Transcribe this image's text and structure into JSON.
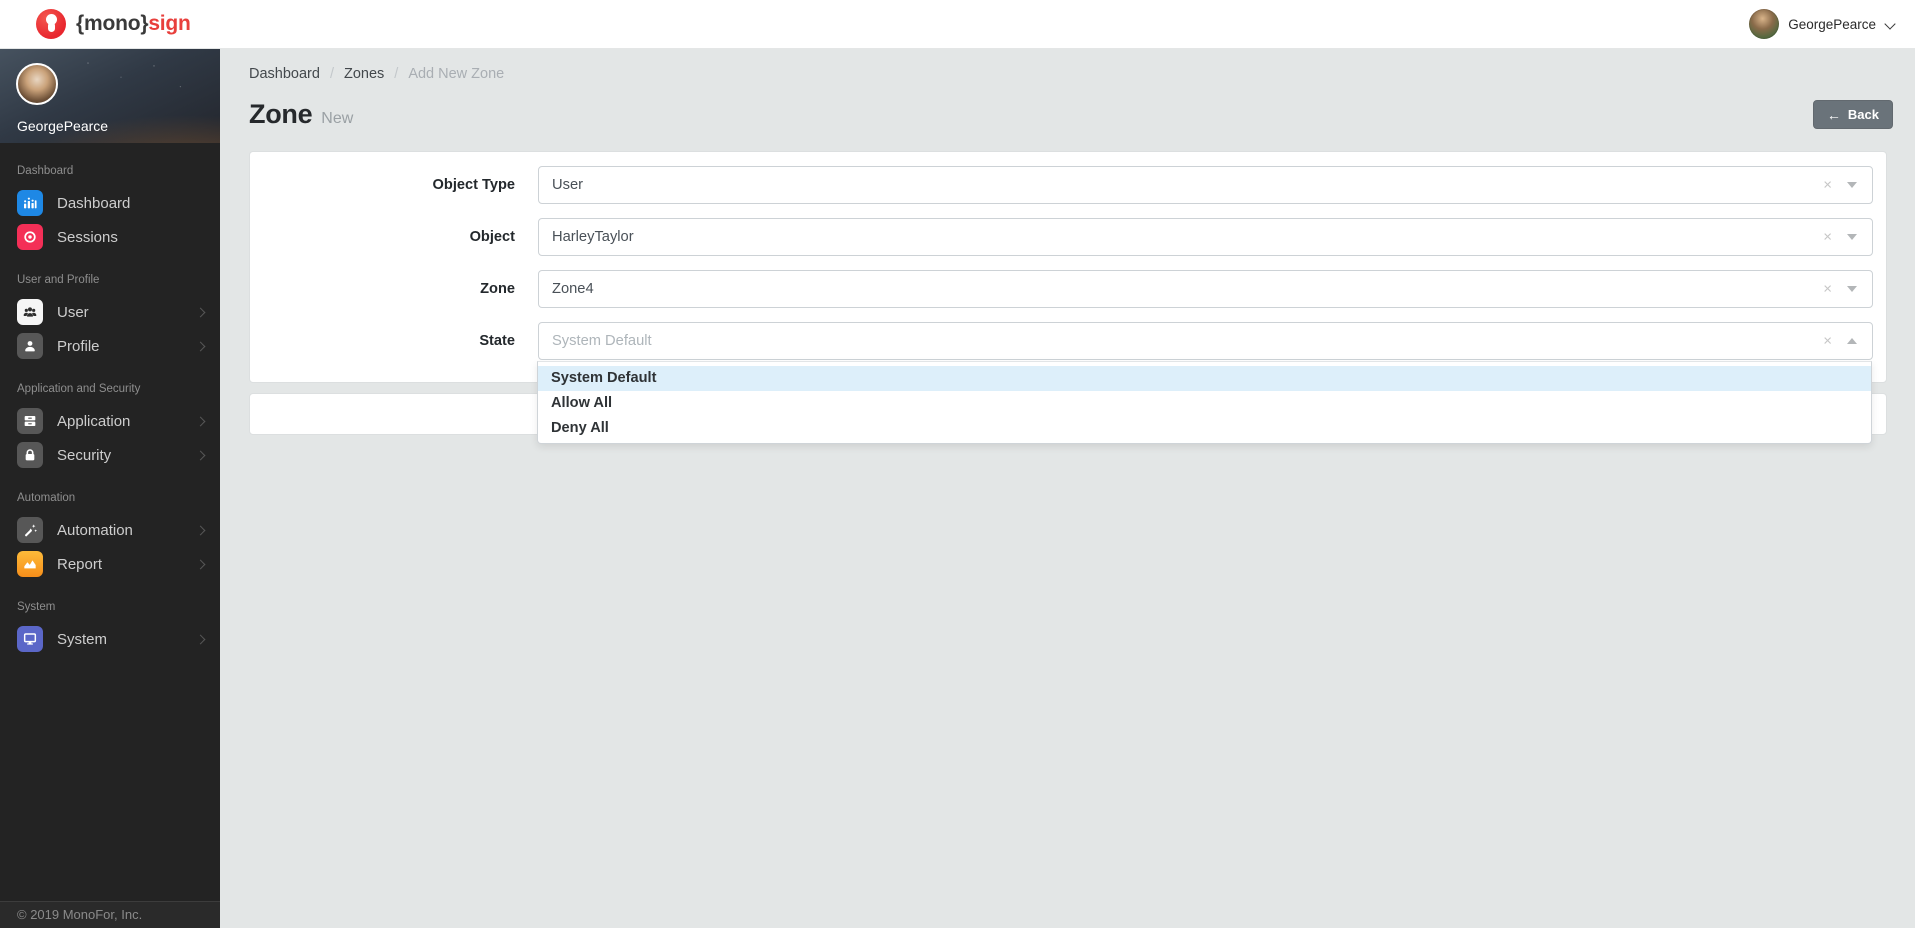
{
  "brand": {
    "mark": "keyhole-logo",
    "name_left": "{mono}",
    "name_right": "sign",
    "red": "#e83f3c"
  },
  "header": {
    "user_name": "GeorgePearce"
  },
  "sidebar": {
    "profile_name": "GeorgePearce",
    "sections": [
      {
        "label": "Dashboard",
        "items": [
          {
            "label": "Dashboard",
            "icon": "dashboard-icon",
            "icon_color": "#1e88e5"
          },
          {
            "label": "Sessions",
            "icon": "sessions-icon",
            "icon_color": "#f42f57"
          }
        ]
      },
      {
        "label": "User and Profile",
        "items": [
          {
            "label": "User",
            "icon": "users-icon",
            "icon_color": "#f5f5f5"
          },
          {
            "label": "Profile",
            "icon": "profile-icon",
            "icon_color": "#575757"
          }
        ]
      },
      {
        "label": "Application and Security",
        "items": [
          {
            "label": "Application",
            "icon": "application-icon",
            "icon_color": "#575757"
          },
          {
            "label": "Security",
            "icon": "security-icon",
            "icon_color": "#575757"
          }
        ]
      },
      {
        "label": "Automation",
        "items": [
          {
            "label": "Automation",
            "icon": "automation-icon",
            "icon_color": "#575757"
          },
          {
            "label": "Report",
            "icon": "report-icon",
            "icon_color": "#f9a11b"
          }
        ]
      },
      {
        "label": "System",
        "items": [
          {
            "label": "System",
            "icon": "system-icon",
            "icon_color": "#5b67c8"
          }
        ]
      }
    ],
    "footer": "© 2019 MonoFor, Inc."
  },
  "breadcrumb": {
    "link1": "Dashboard",
    "link2": "Zones",
    "separator": "/",
    "current": "Add New Zone"
  },
  "page": {
    "title": "Zone",
    "subtitle": "New",
    "back_arrow": "←",
    "back_label": "Back"
  },
  "form": {
    "fields": [
      {
        "label": "Object Type",
        "value": "User"
      },
      {
        "label": "Object",
        "value": "HarleyTaylor"
      },
      {
        "label": "Zone",
        "value": "Zone4"
      },
      {
        "label": "State",
        "placeholder": "System Default"
      }
    ],
    "clear_glyph": "×"
  },
  "dropdown": {
    "options": [
      {
        "label": "System Default",
        "active": true
      },
      {
        "label": "Allow All",
        "active": false
      },
      {
        "label": "Deny All",
        "active": false
      }
    ],
    "active_bg": "#ddeffa"
  }
}
